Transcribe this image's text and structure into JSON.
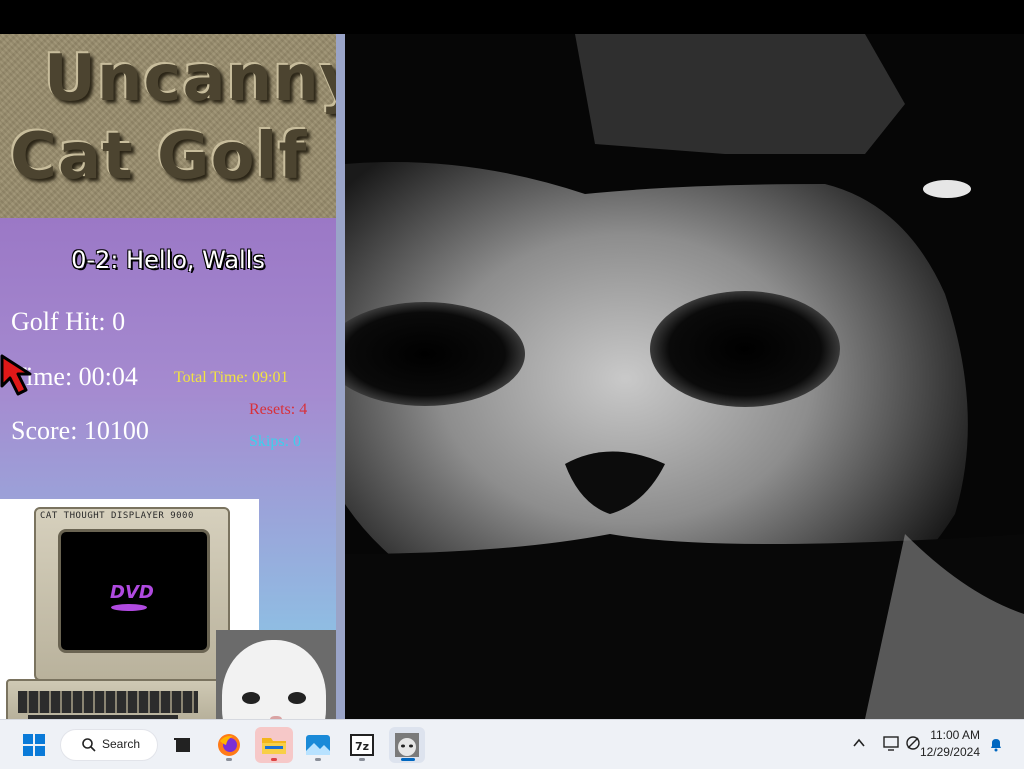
{
  "game": {
    "logo_line1": "Uncanny",
    "logo_line2": "Cat Golf",
    "level_name": "0-2: Hello, Walls",
    "golf_hit_label": "Golf Hit: 0",
    "time_label": "Time: 00:04",
    "score_label": "Score: 10100",
    "total_time_label": "Total Time: 09:01",
    "resets_label": "Resets: 4",
    "skips_label": "Skips: 0",
    "monitor_label": "CAT THOUGHT DISPLAYER 9000",
    "screen_logo": "DVD"
  },
  "taskbar": {
    "search_label": "Search",
    "clock_time": "11:00 AM",
    "clock_date": "12/29/2024",
    "apps": [
      "start",
      "search",
      "task-view",
      "firefox",
      "file-explorer",
      "photos",
      "7-zip",
      "uncanny-cat-golf"
    ]
  },
  "colors": {
    "total_time": "#f2e341",
    "resets": "#d8303a",
    "skips": "#3cd0ec",
    "accent_taskbar": "#0067c0"
  },
  "icons": [
    "cursor-arrow-icon",
    "windows-start-icon",
    "search-icon",
    "task-view-icon",
    "firefox-icon",
    "folder-icon",
    "photos-icon",
    "7zip-icon",
    "cat-app-icon",
    "chevron-up-icon",
    "display-icon",
    "network-icon",
    "notification-bell-icon"
  ]
}
